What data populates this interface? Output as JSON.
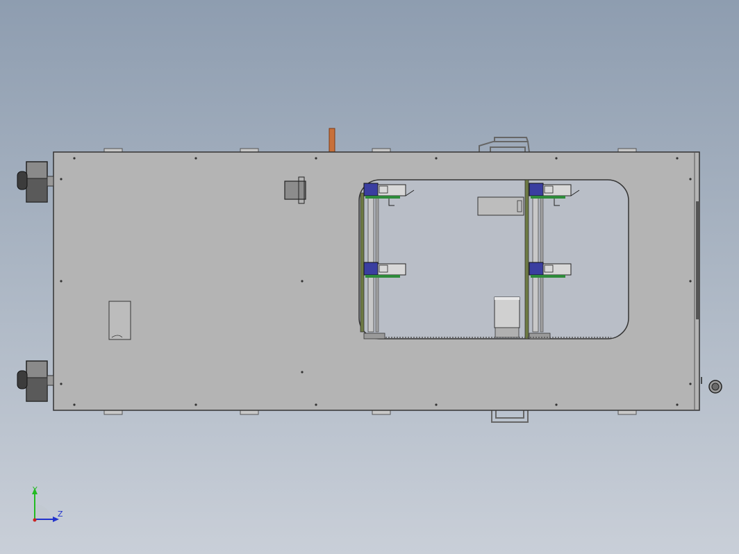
{
  "triad": {
    "y_label": "Y",
    "z_label": "Z",
    "y_color": "#22bb22",
    "z_color": "#2233cc",
    "x_color": "#cc2222"
  },
  "colors": {
    "background_top": "#8e9db0",
    "background_bottom": "#c9cfd8",
    "panel_fill": "#b4b4b4",
    "outline": "#333333",
    "copper_tab": "#c8703a",
    "pcb_green": "#2e8b3a",
    "connector_blue": "#3a3ea0"
  }
}
